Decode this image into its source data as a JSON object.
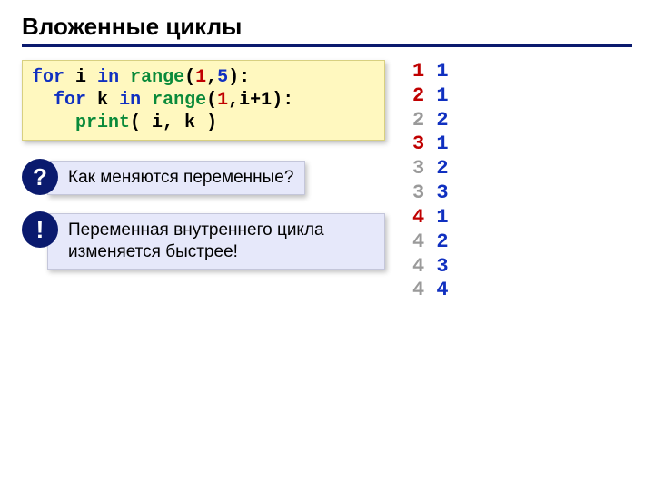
{
  "title": "Вложенные циклы",
  "code": {
    "line1_indent": "",
    "line2_indent": "  ",
    "line3_indent": "    ",
    "kw_for": "for",
    "kw_in": "in",
    "var_i": "i",
    "var_k": "k",
    "fn_range": "range",
    "fn_print": "print",
    "lparen": "(",
    "rparen": ")",
    "colon": ":",
    "comma": ",",
    "sp": " ",
    "num1": "1",
    "num5": "5",
    "iplus1": "i+1",
    "print_args": " i, k "
  },
  "callouts": {
    "q_badge": "?",
    "q_text": "Как меняются переменные?",
    "e_badge": "!",
    "e_text": "Переменная внутреннего цикла изменяется быстрее!"
  },
  "output": [
    {
      "i": "1",
      "k": "1",
      "i_color": "out-red",
      "k_color": "out-blue"
    },
    {
      "i": "2",
      "k": "1",
      "i_color": "out-red",
      "k_color": "out-blue"
    },
    {
      "i": "2",
      "k": "2",
      "i_color": "out-gray",
      "k_color": "out-blue"
    },
    {
      "i": "3",
      "k": "1",
      "i_color": "out-red",
      "k_color": "out-blue"
    },
    {
      "i": "3",
      "k": "2",
      "i_color": "out-gray",
      "k_color": "out-blue"
    },
    {
      "i": "3",
      "k": "3",
      "i_color": "out-gray",
      "k_color": "out-blue"
    },
    {
      "i": "4",
      "k": "1",
      "i_color": "out-red",
      "k_color": "out-blue"
    },
    {
      "i": "4",
      "k": "2",
      "i_color": "out-gray",
      "k_color": "out-blue"
    },
    {
      "i": "4",
      "k": "3",
      "i_color": "out-gray",
      "k_color": "out-blue"
    },
    {
      "i": "4",
      "k": "4",
      "i_color": "out-gray",
      "k_color": "out-blue"
    }
  ]
}
